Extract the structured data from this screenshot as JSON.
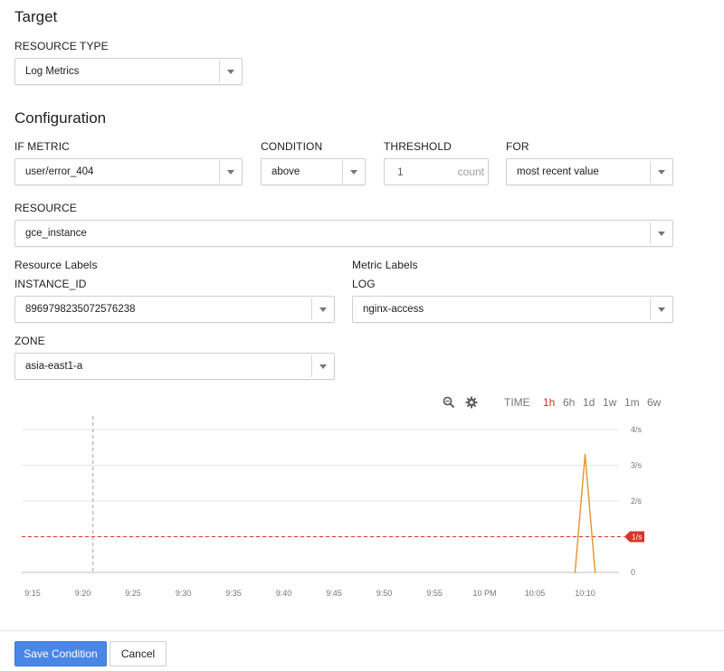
{
  "target": {
    "heading": "Target",
    "resource_type_label": "RESOURCE TYPE",
    "resource_type_value": "Log Metrics"
  },
  "configuration": {
    "heading": "Configuration",
    "if_metric_label": "IF METRIC",
    "if_metric_value": "user/error_404",
    "condition_label": "CONDITION",
    "condition_value": "above",
    "threshold_label": "THRESHOLD",
    "threshold_value": "1",
    "threshold_unit": "count",
    "for_label": "FOR",
    "for_value": "most recent value",
    "resource_label": "RESOURCE",
    "resource_value": "gce_instance",
    "resource_labels_heading": "Resource Labels",
    "metric_labels_heading": "Metric Labels",
    "instance_id_label": "INSTANCE_ID",
    "instance_id_value": "8969798235072576238",
    "log_label": "LOG",
    "log_value": "nginx-access",
    "zone_label": "ZONE",
    "zone_value": "asia-east1-a"
  },
  "chart_toolbar": {
    "zoom_icon": "zoom-icon",
    "settings_icon": "gear-icon",
    "time_label": "TIME",
    "ranges": [
      "1h",
      "6h",
      "1d",
      "1w",
      "1m",
      "6w"
    ],
    "active_range": "1h"
  },
  "chart_data": {
    "type": "line",
    "x_ticks": [
      "9:15",
      "9:20",
      "9:25",
      "9:30",
      "9:35",
      "9:40",
      "9:45",
      "9:50",
      "9:55",
      "10 PM",
      "10:05",
      "10:10"
    ],
    "y_ticks": [
      "0",
      "1/s",
      "2/s",
      "3/s",
      "4/s"
    ],
    "ylim": [
      0,
      4
    ],
    "threshold": 1,
    "threshold_label": "1/s",
    "series": [
      {
        "color": "#e8912b",
        "points": [
          [
            "10:09",
            0
          ],
          [
            "10:10",
            3.3
          ],
          [
            "10:11",
            0
          ]
        ]
      }
    ],
    "markers": [
      {
        "x": "9:21",
        "style": "dashed"
      }
    ],
    "grid": true,
    "colors": {
      "threshold": "#d5372b",
      "series": "#e8912b",
      "grid": "#e6e6e6"
    }
  },
  "footer": {
    "save_label": "Save Condition",
    "cancel_label": "Cancel"
  },
  "colors": {
    "accent": "#4a86e8",
    "active_range": "#c0392b"
  }
}
